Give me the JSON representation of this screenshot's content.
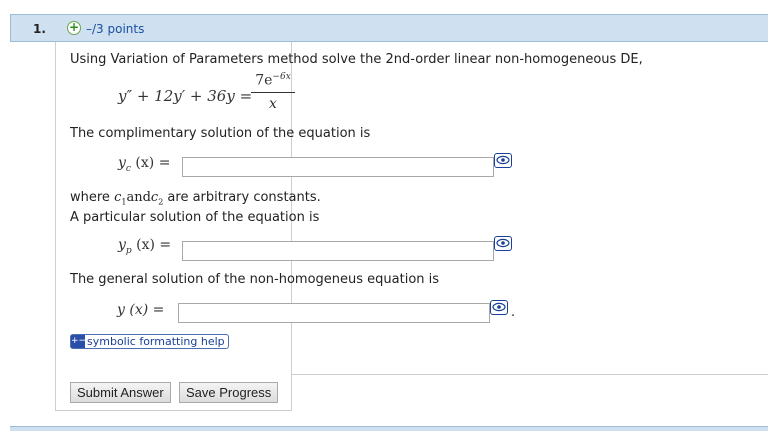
{
  "question": {
    "number": "1.",
    "points": "–/3 points",
    "prompt": "Using Variation of Parameters method solve the 2nd-order linear non-homogeneous DE,",
    "equation_lhs": "y″ + 12y′ + 36y =",
    "equation_rhs_numerator": "7e",
    "equation_rhs_exponent": "−6x",
    "equation_rhs_denominator": "x"
  },
  "parts": {
    "complementary_label": "The complimentary solution of the equation is",
    "complementary_var": "y",
    "complementary_sub": "c",
    "complementary_arg": " (x) =",
    "complementary_value": "",
    "constants_where": "where",
    "constants_c1": "c",
    "constants_c1_sub": "1",
    "constants_and": "and",
    "constants_c2": "c",
    "constants_c2_sub": "2",
    "constants_tail": "are arbitrary constants.",
    "particular_label": "A particular solution of the equation is",
    "particular_var": "y",
    "particular_sub": "p",
    "particular_arg": " (x) =",
    "particular_value": "",
    "general_label": "The general solution of the non-homogeneus equation is",
    "general_lhs": "y (x) =",
    "general_value": "",
    "general_period": "."
  },
  "help": {
    "label": "symbolic formatting help",
    "icon": "+−"
  },
  "buttons": {
    "submit": "Submit Answer",
    "save": "Save Progress"
  },
  "colors": {
    "header_bg": "#cfe0f0",
    "points_link": "#1a4fa0",
    "icon_blue": "#1a3f9a"
  }
}
